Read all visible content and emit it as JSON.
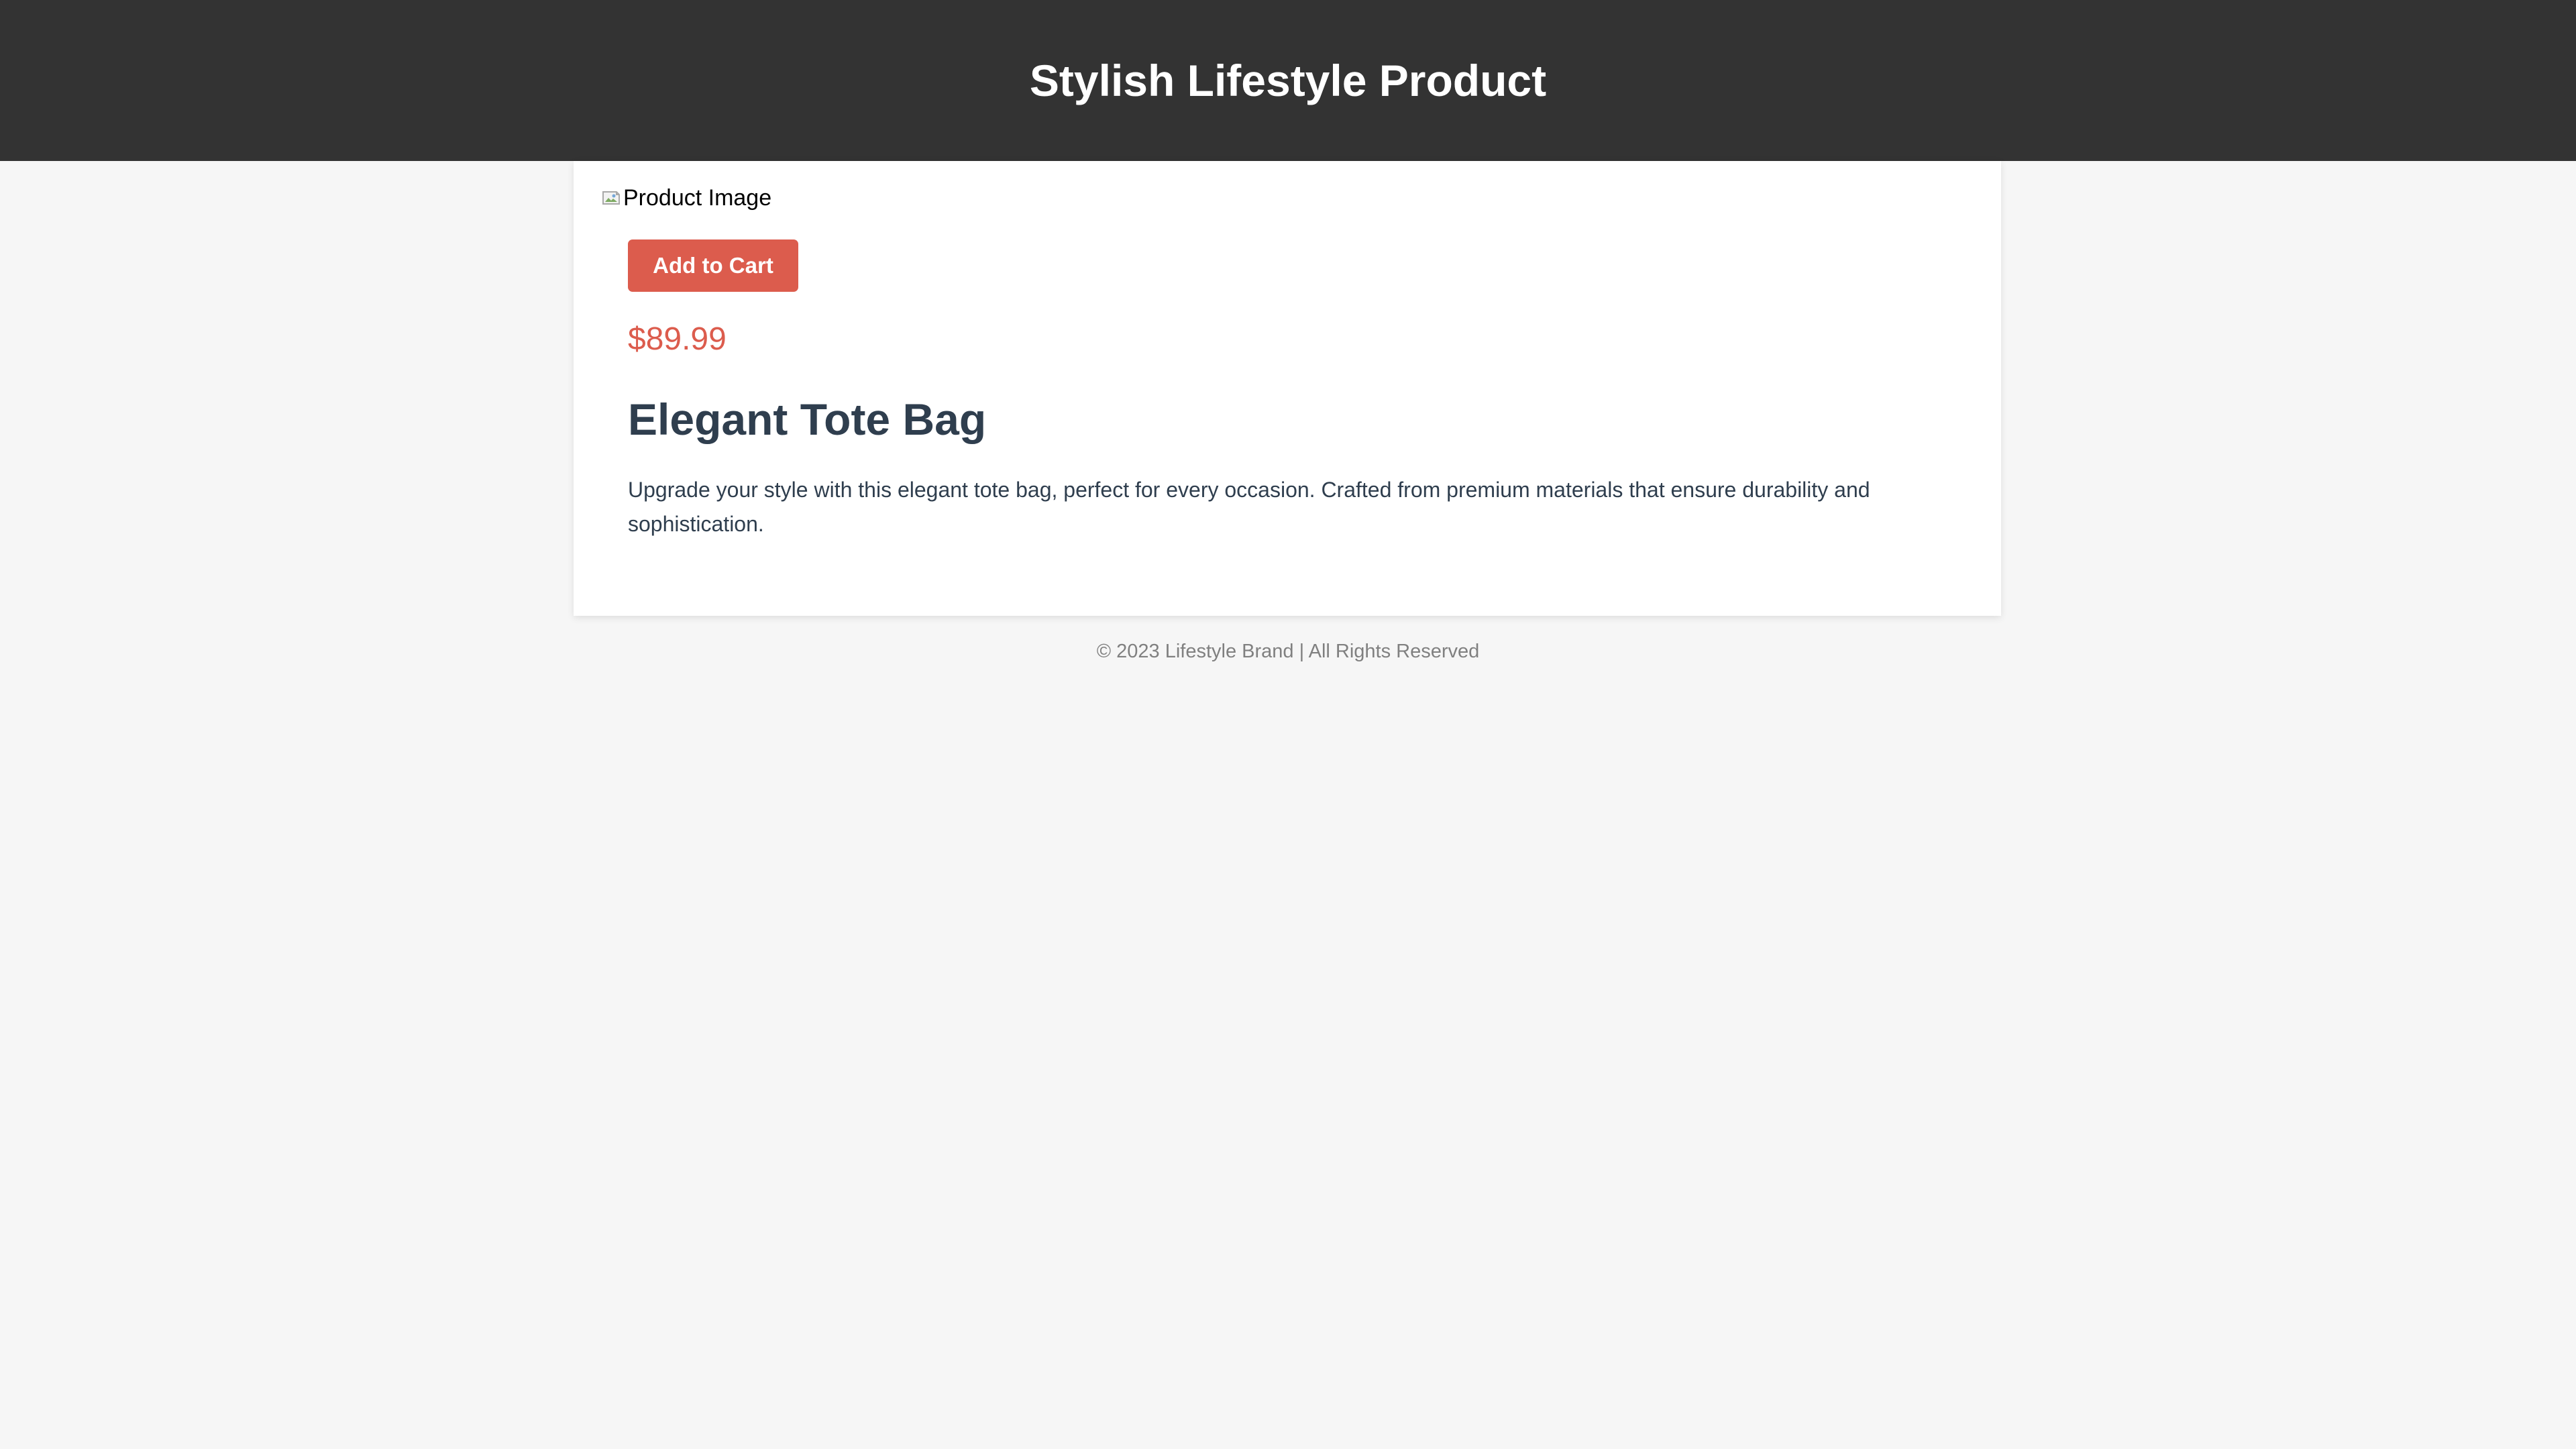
{
  "header": {
    "title": "Stylish Lifestyle Product"
  },
  "product": {
    "image_alt": "Product Image",
    "add_to_cart_label": "Add to Cart",
    "price": "$89.99",
    "name": "Elegant Tote Bag",
    "description": "Upgrade your style with this elegant tote bag, perfect for every occasion. Crafted from premium materials that ensure durability and sophistication."
  },
  "footer": {
    "text": "© 2023 Lifestyle Brand | All Rights Reserved"
  },
  "colors": {
    "header_background": "#333333",
    "page_background": "#f6f6f6",
    "card_background": "#ffffff",
    "accent": "#dc5c4d",
    "text_primary": "#2f3e4e",
    "footer_text": "#808080"
  },
  "icons": {
    "product_image": "broken-image-icon"
  }
}
